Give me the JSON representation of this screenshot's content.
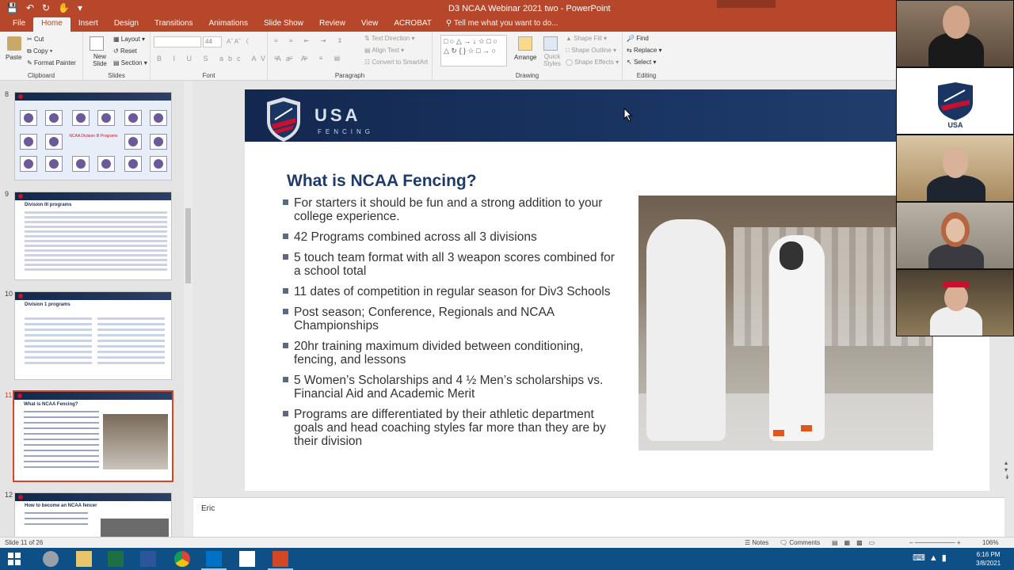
{
  "app": {
    "title": "D3 NCAA Webinar 2021 two - PowerPoint",
    "tabs": [
      "File",
      "Home",
      "Insert",
      "Design",
      "Transitions",
      "Animations",
      "Slide Show",
      "Review",
      "View",
      "ACROBAT"
    ],
    "active_tab": "Home",
    "tell_me": "Tell me what you want to do..."
  },
  "ribbon": {
    "clipboard": {
      "label": "Clipboard",
      "paste": "Paste",
      "cut": "Cut",
      "copy": "Copy",
      "format_painter": "Format Painter"
    },
    "slides": {
      "label": "Slides",
      "new_slide": "New Slide",
      "layout": "Layout",
      "reset": "Reset",
      "section": "Section"
    },
    "font": {
      "label": "Font",
      "size": "44"
    },
    "paragraph": {
      "label": "Paragraph",
      "text_direction": "Text Direction",
      "align_text": "Align Text",
      "convert_smartart": "Convert to SmartArt"
    },
    "drawing": {
      "label": "Drawing",
      "arrange": "Arrange",
      "quick_styles": "Quick Styles",
      "shape_fill": "Shape Fill",
      "shape_outline": "Shape Outline",
      "shape_effects": "Shape Effects"
    },
    "editing": {
      "label": "Editing",
      "find": "Find",
      "replace": "Replace",
      "select": "Select"
    }
  },
  "thumbnails": [
    {
      "num": "8"
    },
    {
      "num": "9",
      "title": "Division III programs"
    },
    {
      "num": "10",
      "title": "Division 1 programs"
    },
    {
      "num": "11",
      "title": "What is NCAA Fencing?",
      "selected": true
    },
    {
      "num": "12",
      "title": "How to become an NCAA fencer"
    }
  ],
  "slide": {
    "logo_text": "USA",
    "logo_subtext": "FENCING",
    "title": "What is NCAA Fencing?",
    "bullets": [
      "For starters it should be fun and a strong addition to your college experience.",
      "42 Programs combined across all 3 divisions",
      "5 touch team format with all 3 weapon scores combined for a school total",
      "11 dates of competition in regular season for Div3 Schools",
      "Post season; Conference, Regionals and NCAA Championships",
      "20hr training maximum divided between conditioning, fencing, and lessons",
      "5 Women’s Scholarships and 4 ½ Men’s scholarships vs. Financial Aid and Academic Merit",
      "Programs are differentiated by their athletic department goals and head coaching styles far more than they are by their division"
    ]
  },
  "notes": "Eric",
  "status": {
    "slide_count": "Slide 11 of 26",
    "notes": "Notes",
    "comments": "Comments",
    "zoom": "106%"
  },
  "clock": {
    "time": "6:16 PM",
    "date": "3/8/2021"
  },
  "colors": {
    "accent": "#b7472a",
    "slide_title": "#1d3a68",
    "banner": "#13284f",
    "selection": "#d24726"
  }
}
